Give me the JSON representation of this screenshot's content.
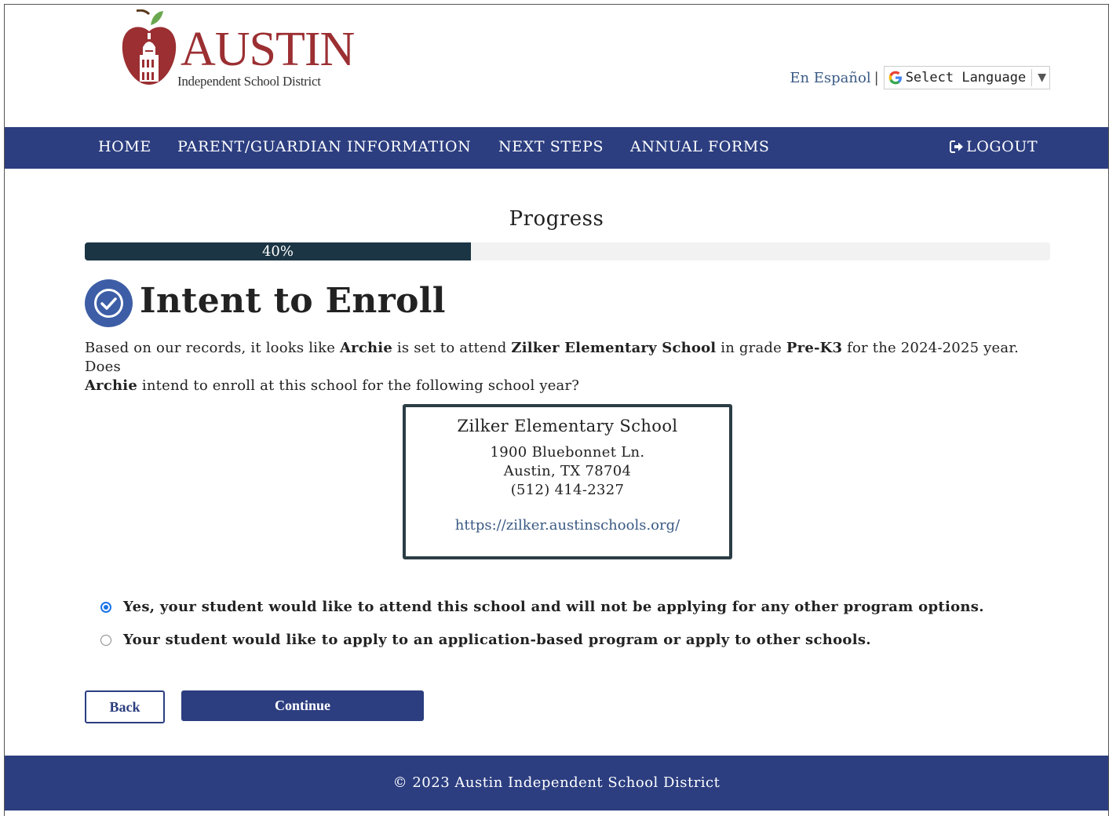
{
  "header": {
    "logo_word": "AUSTIN",
    "logo_subtitle": "Independent School District",
    "espanol_link": "En Español",
    "separator": "|",
    "language_select": "Select Language",
    "language_arrow": "▼"
  },
  "nav": {
    "items": [
      {
        "label": "HOME"
      },
      {
        "label": "PARENT/GUARDIAN INFORMATION"
      },
      {
        "label": "NEXT STEPS"
      },
      {
        "label": "ANNUAL FORMS"
      }
    ],
    "logout": "LOGOUT"
  },
  "progress": {
    "title": "Progress",
    "label": "40%",
    "value": 0.4
  },
  "page": {
    "title": "Intent to Enroll",
    "intro": {
      "t1": "Based on our records, it looks like ",
      "student": "Archie",
      "t2": " is set to attend ",
      "school": "Zilker Elementary School",
      "t3": " in grade ",
      "grade": "Pre-K3",
      "t4": " for the 2024-2025 year. Does ",
      "student2": "Archie",
      "t5": " intend to enroll at this school for the following school year?"
    }
  },
  "school": {
    "name": "Zilker Elementary School",
    "street": "1900 Bluebonnet Ln.",
    "city": "Austin, TX 78704",
    "phone": "(512) 414-2327",
    "url": "https://zilker.austinschools.org/"
  },
  "options": [
    {
      "label": "Yes, your student would like to attend this school and will not be applying for any other program options.",
      "checked": true
    },
    {
      "label": "Your student would like to apply to an application-based program or apply to other schools.",
      "checked": false
    }
  ],
  "buttons": {
    "back": "Back",
    "continue": "Continue"
  },
  "footer": {
    "text": "© 2023 Austin Independent School District"
  },
  "colors": {
    "brand_navy": "#2c3e80",
    "logo_red": "#9b2f32",
    "progress_fill": "#1b3544",
    "link_blue": "#3a5a84"
  }
}
